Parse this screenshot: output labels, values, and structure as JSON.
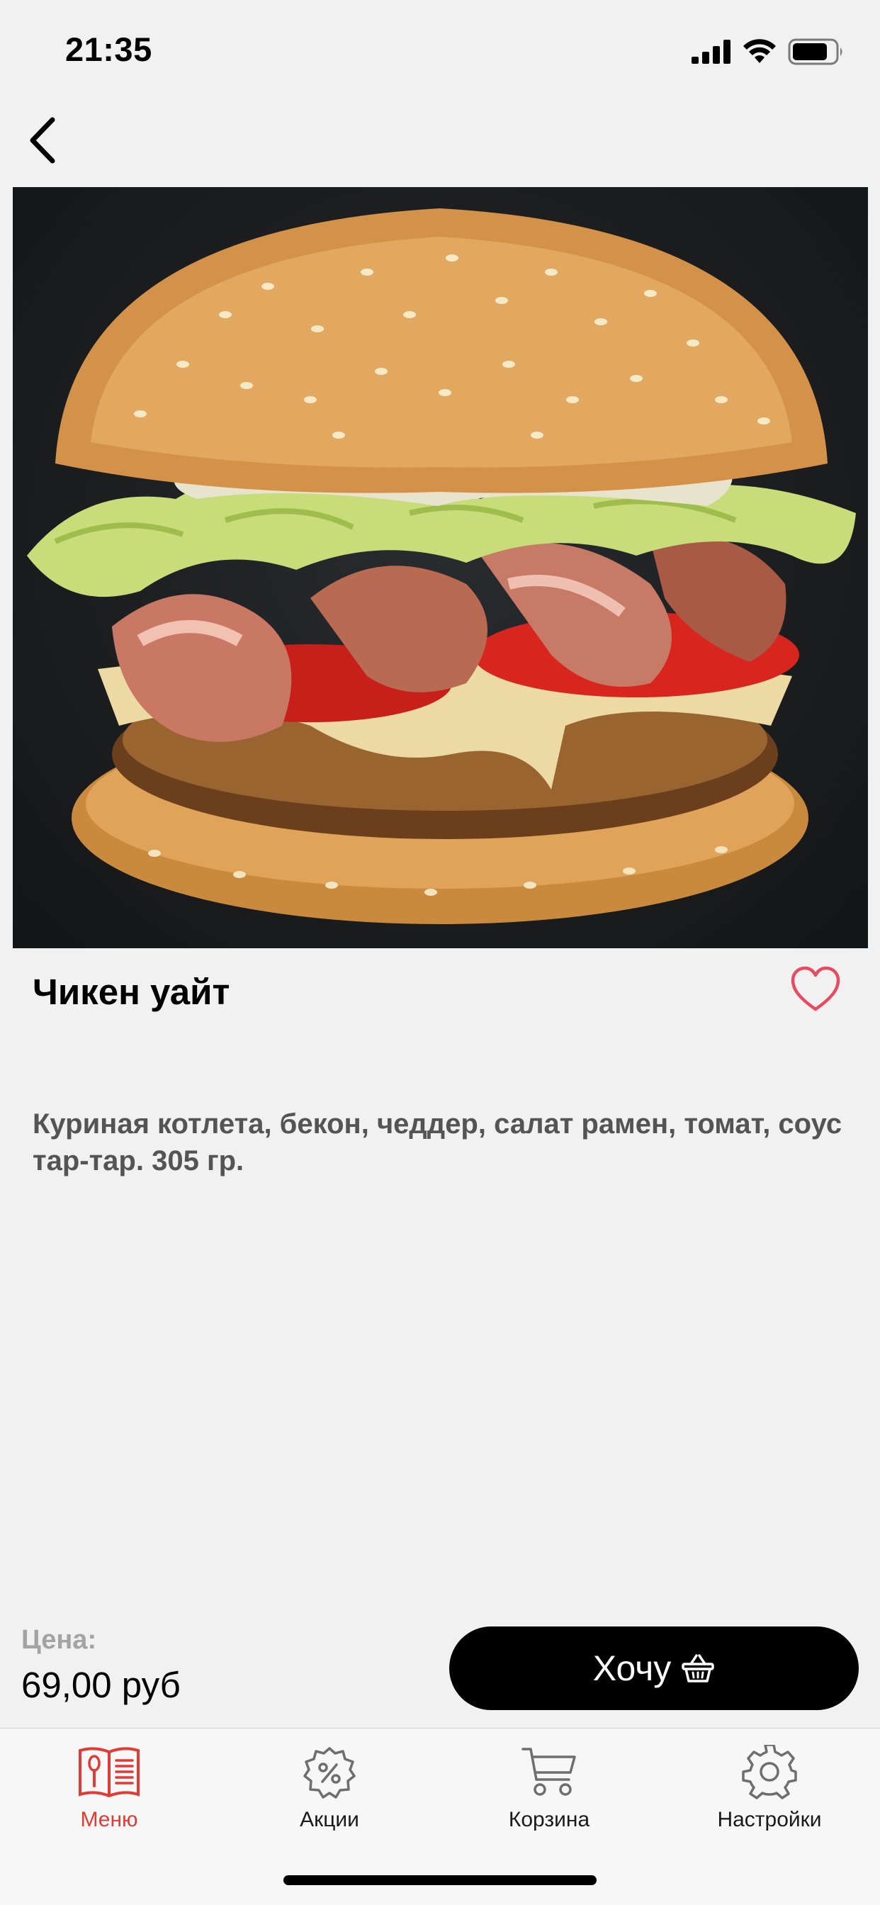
{
  "status_bar": {
    "time": "21:35"
  },
  "product": {
    "name": "Чикен уайт",
    "description": "Куриная котлета, бекон, чеддер, салат рамен, томат, соус тар-тар. 305 гр.",
    "image_icon": "burger-photo",
    "favorite_icon": "heart-outline-icon"
  },
  "price": {
    "label": "Цена:",
    "value": "69,00 руб"
  },
  "cta": {
    "label": "Хочу",
    "icon": "basket-icon"
  },
  "tabs": [
    {
      "label": "Меню",
      "icon": "menu-book-icon",
      "active": true
    },
    {
      "label": "Акции",
      "icon": "discount-gear-icon",
      "active": false
    },
    {
      "label": "Корзина",
      "icon": "cart-icon",
      "active": false
    },
    {
      "label": "Настройки",
      "icon": "settings-gear-icon",
      "active": false
    }
  ],
  "colors": {
    "accent": "#e23b33",
    "background": "#f1f1f1",
    "cta": "#000000",
    "heart": "#e84a5f"
  }
}
